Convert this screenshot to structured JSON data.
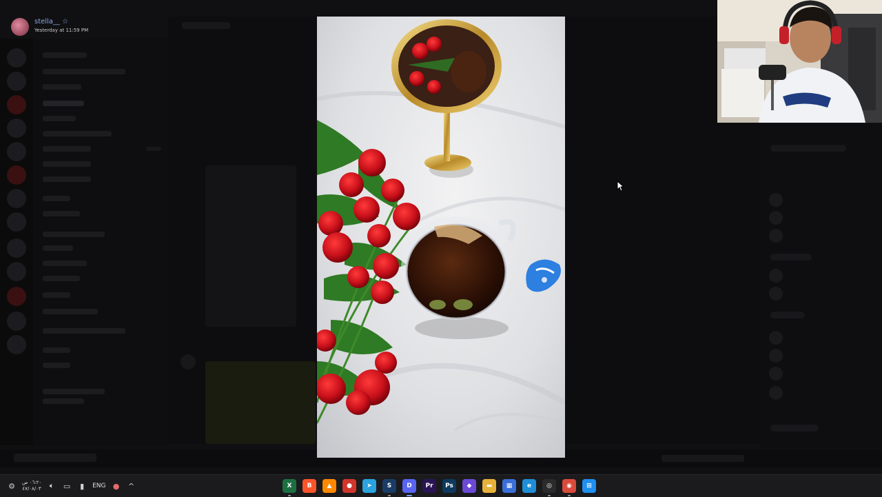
{
  "header": {
    "username": "stella__",
    "star": "☆",
    "timestamp": "Yesterday at 11:59 PM"
  },
  "taskbar": {
    "clock_time": "٠٦:٢٠ ص",
    "clock_date": "٤٧/٠٨/٠٣",
    "language": "ENG",
    "apps": [
      {
        "icon": "excel-icon",
        "glyph": "X",
        "color": "#1d6f42",
        "state": "dot"
      },
      {
        "icon": "brave-icon",
        "glyph": "B",
        "color": "#fb542b",
        "state": ""
      },
      {
        "icon": "vlc-icon",
        "glyph": "▲",
        "color": "#ff8800",
        "state": ""
      },
      {
        "icon": "app-red-icon",
        "glyph": "●",
        "color": "#d0362c",
        "state": ""
      },
      {
        "icon": "telegram-icon",
        "glyph": "➤",
        "color": "#2aa3df",
        "state": ""
      },
      {
        "icon": "steam-icon",
        "glyph": "S",
        "color": "#1a3c66",
        "state": "dot"
      },
      {
        "icon": "discord-icon",
        "glyph": "D",
        "color": "#5865f2",
        "state": "active"
      },
      {
        "icon": "premiere-icon",
        "glyph": "Pr",
        "color": "#2a1454",
        "state": ""
      },
      {
        "icon": "photoshop-icon",
        "glyph": "Ps",
        "color": "#0c3a5c",
        "state": ""
      },
      {
        "icon": "app-purple-icon",
        "glyph": "◆",
        "color": "#6b4ad6",
        "state": ""
      },
      {
        "icon": "file-explorer-icon",
        "glyph": "▬",
        "color": "#e8b23a",
        "state": ""
      },
      {
        "icon": "ms-store-icon",
        "glyph": "▦",
        "color": "#3a6fd8",
        "state": ""
      },
      {
        "icon": "edge-icon",
        "glyph": "e",
        "color": "#1e8fd6",
        "state": ""
      },
      {
        "icon": "obs-icon",
        "glyph": "◎",
        "color": "#2b2b2b",
        "state": "dot"
      },
      {
        "icon": "chrome-icon",
        "glyph": "◉",
        "color": "#d94a3a",
        "state": "dot"
      },
      {
        "icon": "windows-start-icon",
        "glyph": "⊞",
        "color": "#1f8ff0",
        "state": ""
      }
    ]
  }
}
